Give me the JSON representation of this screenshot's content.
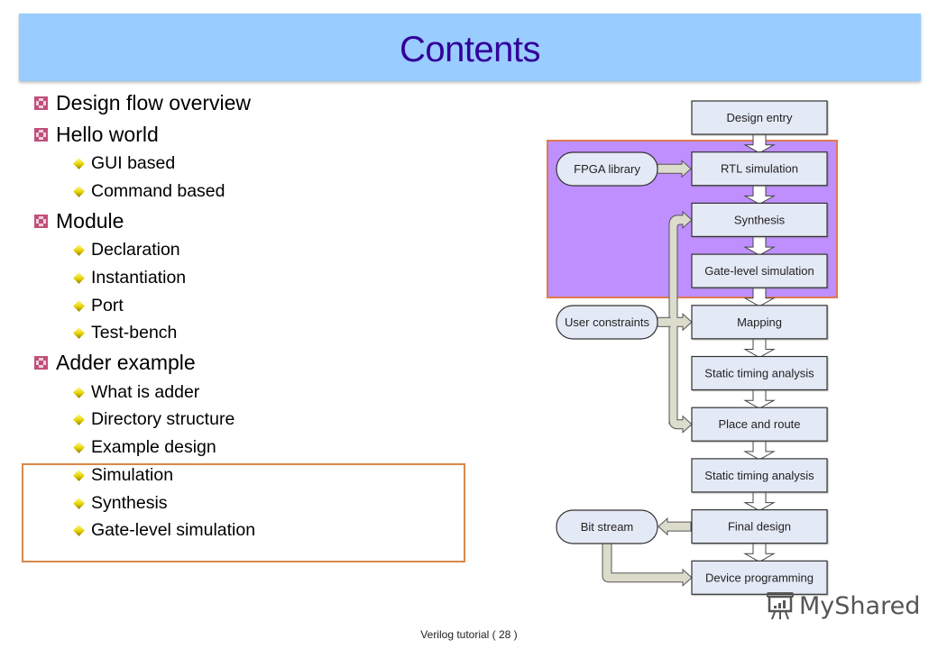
{
  "slide": {
    "title": "Contents",
    "footer": "Verilog tutorial  ( 28 )",
    "watermark": "MyShared"
  },
  "colors": {
    "title_bar": "#99ccff",
    "title_text": "#330099",
    "highlight_border": "#d9884a",
    "purple_region": "#bf8fff",
    "box_fill": "#e4e9f6",
    "arrow_fill": "#dcdccc"
  },
  "outline": [
    {
      "level": 1,
      "label": "Design flow overview"
    },
    {
      "level": 1,
      "label": "Hello world"
    },
    {
      "level": 2,
      "label": "GUI based"
    },
    {
      "level": 2,
      "label": "Command based"
    },
    {
      "level": 1,
      "label": "Module"
    },
    {
      "level": 2,
      "label": "Declaration"
    },
    {
      "level": 2,
      "label": "Instantiation"
    },
    {
      "level": 2,
      "label": "Port"
    },
    {
      "level": 2,
      "label": "Test-bench"
    },
    {
      "level": 1,
      "label": "Adder example"
    },
    {
      "level": 2,
      "label": "What is adder"
    },
    {
      "level": 2,
      "label": "Directory structure"
    },
    {
      "level": 2,
      "label": "Example design"
    },
    {
      "level": 2,
      "label": "Simulation",
      "highlighted": true
    },
    {
      "level": 2,
      "label": "Synthesis",
      "highlighted": true
    },
    {
      "level": 2,
      "label": "Gate-level simulation",
      "highlighted": true
    }
  ],
  "diagram": {
    "steps": [
      "Design entry",
      "RTL simulation",
      "Synthesis",
      "Gate-level simulation",
      "Mapping",
      "Static timing analysis",
      "Place and route",
      "Static timing analysis",
      "Final design",
      "Device programming"
    ],
    "inputs": {
      "fpga_library": "FPGA library",
      "user_constraints": "User constraints",
      "bit_stream": "Bit stream"
    },
    "highlighted_steps": [
      "RTL simulation",
      "Synthesis",
      "Gate-level simulation"
    ]
  }
}
